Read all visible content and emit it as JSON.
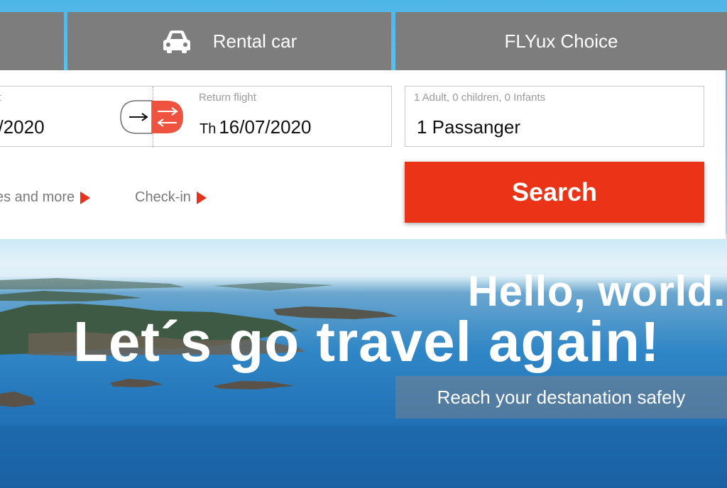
{
  "tabs": {
    "rental_car": "Rental car",
    "choice": "FLYux Choice",
    "car_icon": "car-icon"
  },
  "booking": {
    "departure_label": "ht",
    "departure_date": "7/2020",
    "return_label": "Return flight",
    "return_prefix": "Th",
    "return_date": "16/07/2020",
    "passengers_label": "1 Adult, 0 children, 0 Infants",
    "passengers_value": "1  Passanger",
    "swap_icon": "swap-arrows-icon"
  },
  "links": {
    "more": "es and more",
    "checkin": "Check-in"
  },
  "search": {
    "label": "Search"
  },
  "hero": {
    "hello": "Hello, world.",
    "headline": "Let´s go travel again!",
    "tagline": "Reach your destanation safely"
  },
  "colors": {
    "accent": "#ea3317",
    "tab_gray": "#7d7d7d",
    "panel_bg": "#ffffff"
  }
}
